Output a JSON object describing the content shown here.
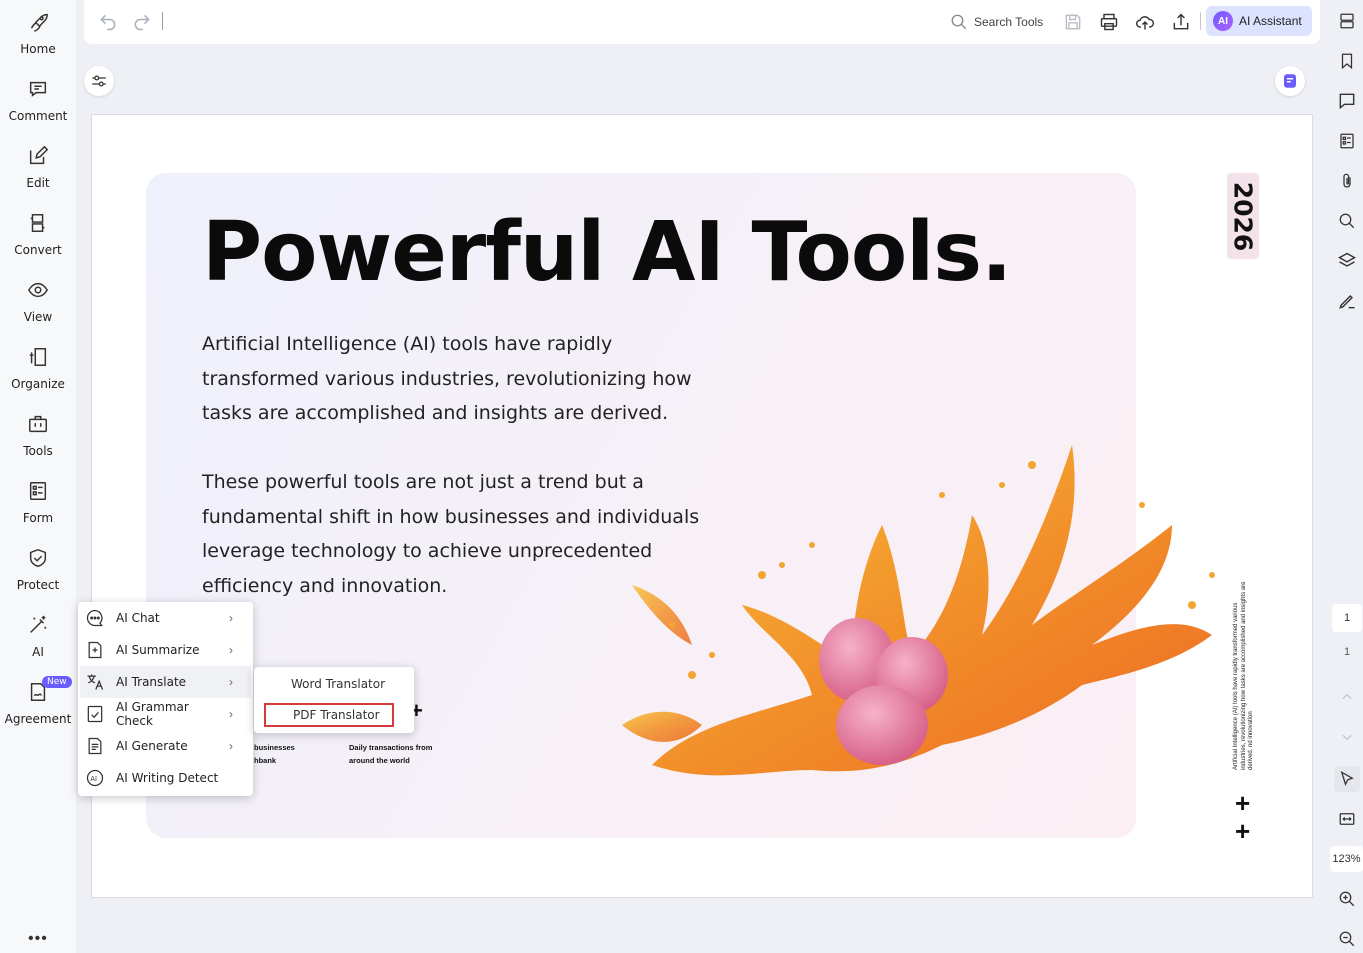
{
  "sidebar": {
    "items": [
      {
        "label": "Home",
        "icon": "rocket-icon"
      },
      {
        "label": "Comment",
        "icon": "comment-icon"
      },
      {
        "label": "Edit",
        "icon": "edit-icon"
      },
      {
        "label": "Convert",
        "icon": "convert-icon"
      },
      {
        "label": "View",
        "icon": "eye-icon"
      },
      {
        "label": "Organize",
        "icon": "organize-icon"
      },
      {
        "label": "Tools",
        "icon": "toolbox-icon"
      },
      {
        "label": "Form",
        "icon": "form-icon"
      },
      {
        "label": "Protect",
        "icon": "shield-icon"
      },
      {
        "label": "AI",
        "icon": "magic-wand-icon"
      },
      {
        "label": "Agreement",
        "icon": "agreement-icon",
        "badge": "New"
      }
    ],
    "more": "•••"
  },
  "toolbar": {
    "search_label": "Search Tools",
    "ai_assistant_label": "AI Assistant",
    "ai_badge": "AI"
  },
  "document": {
    "title": "Powerful AI Tools.",
    "paragraph1": "Artificial Intelligence (AI) tools have rapidly transformed various industries, revolutionizing how tasks are accomplished and insights are derived.",
    "paragraph2": "These powerful tools are not just a trend but a fundamental shift in how businesses and individuals leverage technology to achieve unprecedented efficiency and innovation.",
    "year": "2026",
    "side_note": "Artificial Intelligence (AI) tools have rapidly transformed various industries, revolutionizing how tasks are accomplished and insights are derived. nd innovation",
    "stat_left": "businesses\nhbank",
    "stat_right": "Daily transactions from\naround the world",
    "plus": "+"
  },
  "ai_menu": {
    "items": [
      {
        "label": "AI Chat",
        "icon": "ai-chat-icon",
        "submenu": true
      },
      {
        "label": "AI Summarize",
        "icon": "ai-summarize-icon",
        "submenu": true
      },
      {
        "label": "AI Translate",
        "icon": "ai-translate-icon",
        "submenu": true,
        "active": true
      },
      {
        "label": "AI Grammar Check",
        "icon": "ai-grammar-icon",
        "submenu": true
      },
      {
        "label": "AI Generate",
        "icon": "ai-generate-icon",
        "submenu": true
      },
      {
        "label": "AI Writing Detect",
        "icon": "ai-detect-icon",
        "submenu": false
      }
    ],
    "translate_submenu": [
      {
        "label": "Word Translator"
      },
      {
        "label": "PDF Translator",
        "highlighted": true
      }
    ]
  },
  "right_panel": {
    "current_page": "1",
    "total_pages": "1",
    "zoom": "123%"
  },
  "colors": {
    "accent": "#6b5cff",
    "highlight_border": "#d63b3b",
    "ai_button_bg": "#dde3ff"
  }
}
